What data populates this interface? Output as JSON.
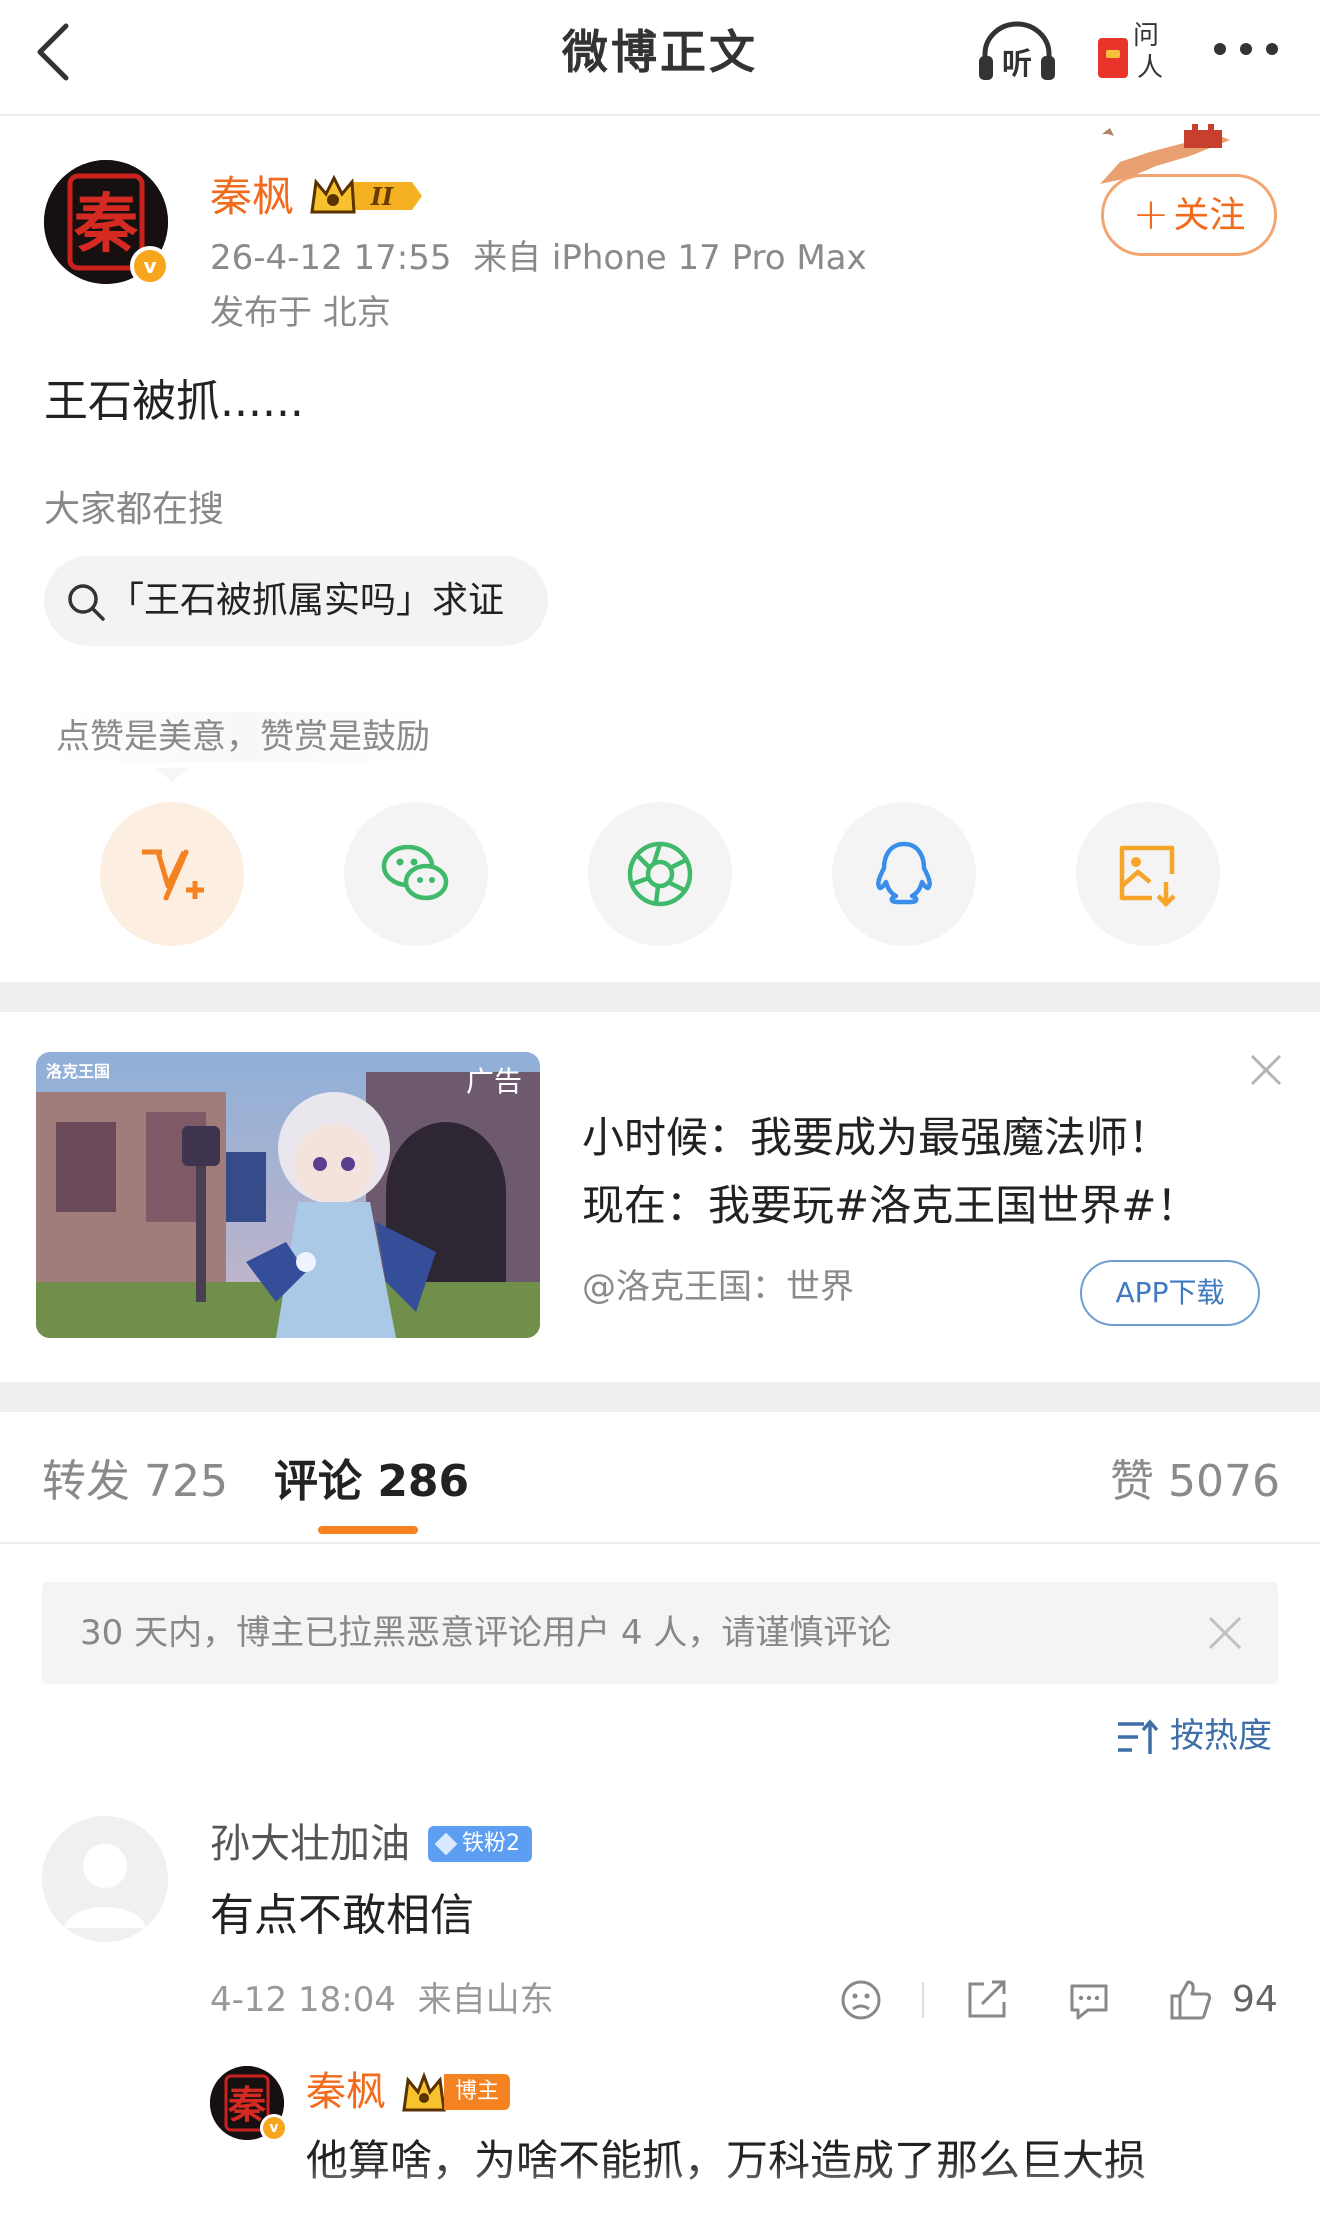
{
  "header": {
    "title": "微博正文",
    "listen_label": "听",
    "ask_label": "问人"
  },
  "author": {
    "name": "秦枫",
    "avatar_char": "秦",
    "verified_mark": "v",
    "level_badge": "II",
    "time": "26-4-12 17:55",
    "source": "来自 iPhone 17 Pro Max",
    "location": "发布于 北京",
    "follow_label": "关注",
    "follow_plus": "+"
  },
  "post": {
    "text": "王石被抓......"
  },
  "search_block": {
    "label": "大家都在搜",
    "query": "「王石被抓属实吗」求证"
  },
  "share": {
    "tip": "点赞是美意，赞赏是鼓励",
    "items": [
      "reward-icon",
      "wechat-icon",
      "moments-icon",
      "qq-icon",
      "save-image-icon"
    ]
  },
  "ad": {
    "tag": "广告",
    "image_logo": "洛克王国",
    "line1": "小时候：我要成为最强魔法师！",
    "line2": "现在：我要玩#洛克王国世界#！",
    "source": "@洛克王国：世界",
    "button": "APP下载"
  },
  "tabs": {
    "repost": "转发 725",
    "comment": "评论 286",
    "like": "赞 5076"
  },
  "notice": {
    "text": "30 天内，博主已拉黑恶意评论用户 4 人，请谨慎评论"
  },
  "sort": {
    "label": "按热度"
  },
  "comment": {
    "user": "孙大壮加油",
    "fan_badge": "铁粉2",
    "text": "有点不敢相信",
    "time": "4-12 18:04",
    "source": "来自山东",
    "likes": "94"
  },
  "reply": {
    "user": "秦枫",
    "avatar_char": "秦",
    "verified_mark": "v",
    "badge": "博主",
    "text": "他算啥，为啥不能抓，万科造成了那么巨大损"
  },
  "colors": {
    "accent_orange": "#f26b1d",
    "link_blue": "#3f6fa6",
    "fan_badge_blue": "#5c9ff2"
  }
}
